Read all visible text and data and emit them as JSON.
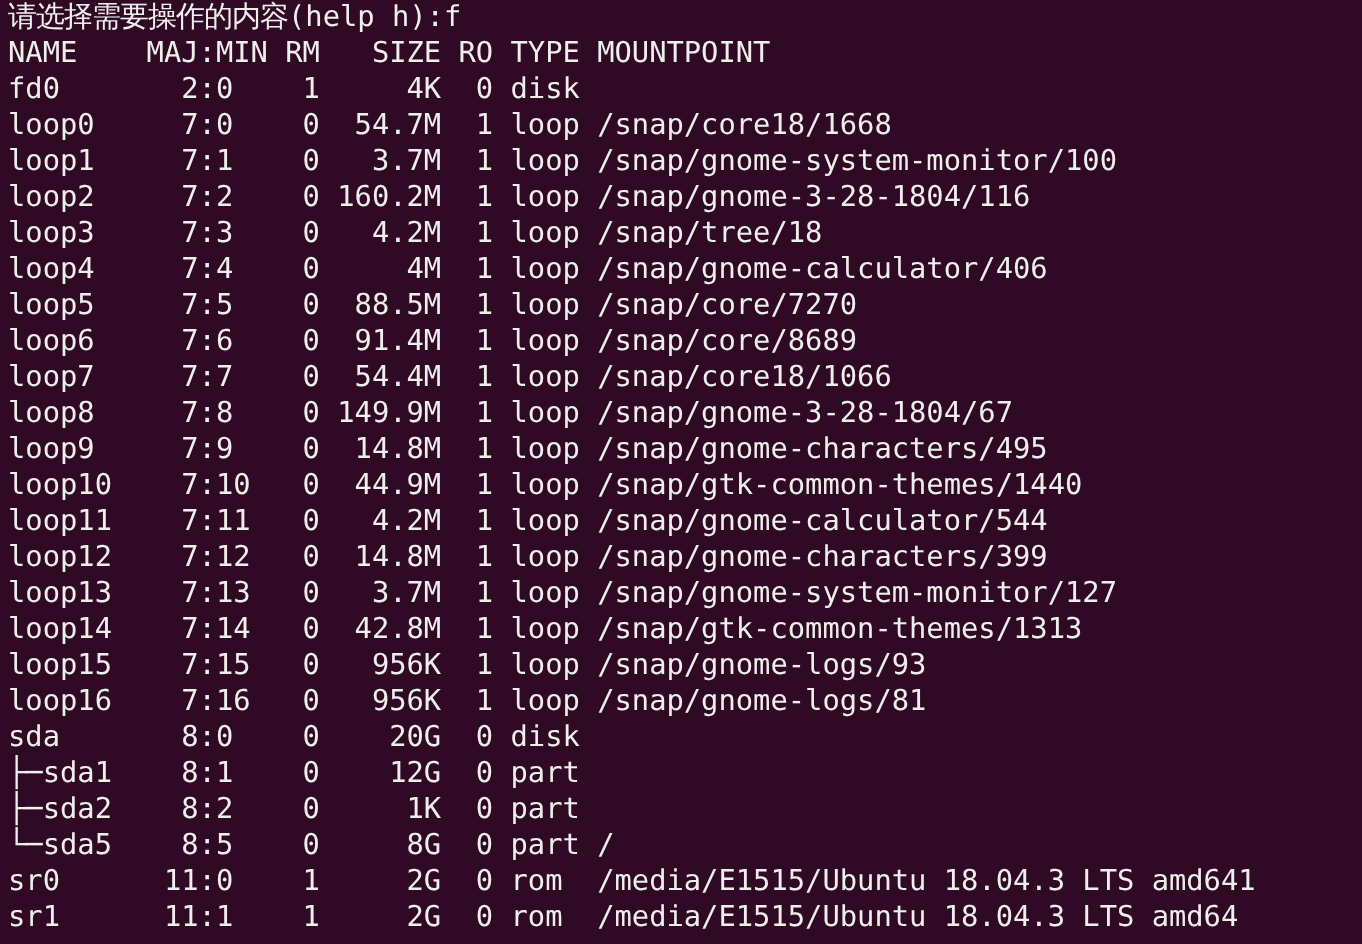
{
  "terminal": {
    "prompt": "请选择需要操作的内容(help h):f",
    "lines": [
      "NAME    MAJ:MIN RM   SIZE RO TYPE MOUNTPOINT",
      "fd0       2:0    1     4K  0 disk",
      "loop0     7:0    0  54.7M  1 loop /snap/core18/1668",
      "loop1     7:1    0   3.7M  1 loop /snap/gnome-system-monitor/100",
      "loop2     7:2    0 160.2M  1 loop /snap/gnome-3-28-1804/116",
      "loop3     7:3    0   4.2M  1 loop /snap/tree/18",
      "loop4     7:4    0     4M  1 loop /snap/gnome-calculator/406",
      "loop5     7:5    0  88.5M  1 loop /snap/core/7270",
      "loop6     7:6    0  91.4M  1 loop /snap/core/8689",
      "loop7     7:7    0  54.4M  1 loop /snap/core18/1066",
      "loop8     7:8    0 149.9M  1 loop /snap/gnome-3-28-1804/67",
      "loop9     7:9    0  14.8M  1 loop /snap/gnome-characters/495",
      "loop10    7:10   0  44.9M  1 loop /snap/gtk-common-themes/1440",
      "loop11    7:11   0   4.2M  1 loop /snap/gnome-calculator/544",
      "loop12    7:12   0  14.8M  1 loop /snap/gnome-characters/399",
      "loop13    7:13   0   3.7M  1 loop /snap/gnome-system-monitor/127",
      "loop14    7:14   0  42.8M  1 loop /snap/gtk-common-themes/1313",
      "loop15    7:15   0   956K  1 loop /snap/gnome-logs/93",
      "loop16    7:16   0   956K  1 loop /snap/gnome-logs/81",
      "sda       8:0    0    20G  0 disk",
      "├─sda1    8:1    0    12G  0 part",
      "├─sda2    8:2    0     1K  0 part",
      "└─sda5    8:5    0     8G  0 part /",
      "sr0      11:0    1     2G  0 rom  /media/E1515/Ubuntu 18.04.3 LTS amd641",
      "sr1      11:1    1     2G  0 rom  /media/E1515/Ubuntu 18.04.3 LTS amd64"
    ]
  }
}
